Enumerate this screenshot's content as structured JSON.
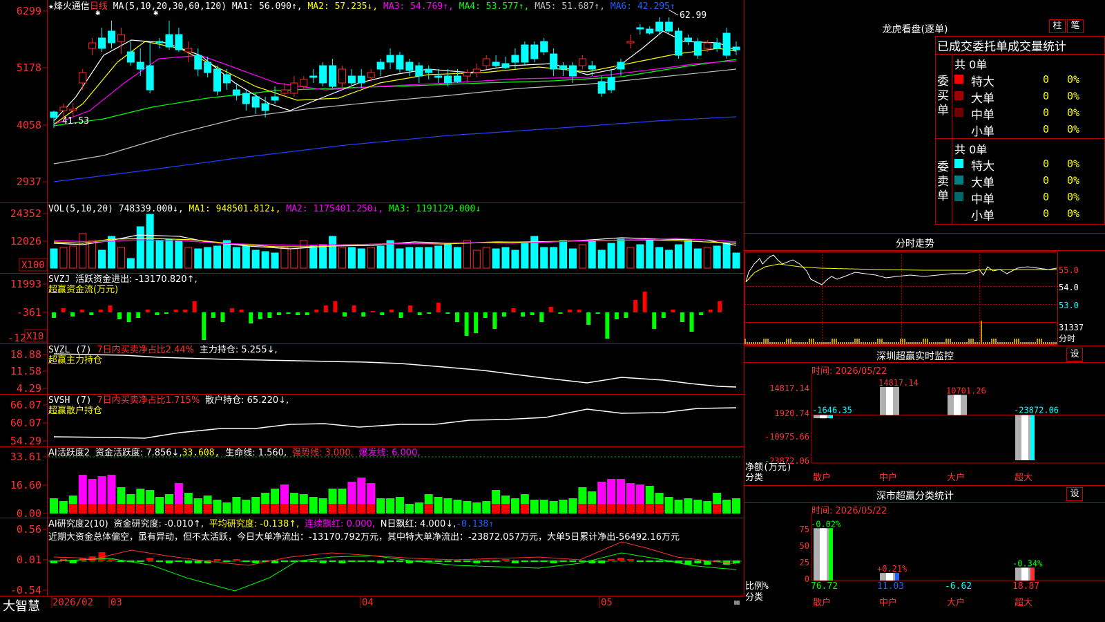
{
  "colors": {
    "up": "#ff2a2a",
    "down": "#00ffff",
    "bg": "#000000",
    "grid": "#c00000",
    "ma1": "#ffffff",
    "ma2": "#ffff00",
    "ma3": "#ff00ff",
    "ma4": "#00ff00",
    "ma5": "#c0c0c0",
    "ma6": "#2040ff",
    "green": "#00ff00",
    "yellow": "#ffff00",
    "magenta": "#ff00ff",
    "axis_text": "#ff3030"
  },
  "kline": {
    "star": "★",
    "name": "烽火通信",
    "period": "日线",
    "ma_prefix": "MA(5,10,20,30,60,120)",
    "ma1": "MA1: 56.090↑,",
    "ma2": "MA2: 57.235↓,",
    "ma3": "MA3: 54.769↑,",
    "ma4": "MA4: 53.577↑,",
    "ma5": "MA5: 51.687↑,",
    "ma6": "MA6: 42.295↑",
    "axis": [
      "6299",
      "5178",
      "4058",
      "2937"
    ],
    "high_label": "62.99",
    "low_label": "41.53"
  },
  "vol": {
    "title": "VOL(5,10,20)",
    "value": "748339.000↓,",
    "ma1": "MA1: 948501.812↓,",
    "ma2": "MA2: 1175401.250↓,",
    "ma3": "MA3: 1191129.000↓",
    "axis": [
      "24352",
      "12026"
    ],
    "unit": "X100"
  },
  "svzj": {
    "title": "SVZJ",
    "title2": "活跃资金进出: -13170.820↑,",
    "sub": "超赢资金流(万元)",
    "axis": [
      "11993",
      "-361",
      "-12"
    ],
    "unit": "X10"
  },
  "svzl": {
    "title": "SVZL (7)",
    "red": "7日内买卖净占比2.44%",
    "white": "主力持仓: 5.255↓,",
    "sub": "超赢主力持仓",
    "axis": [
      "18.88",
      "11.58",
      "4.29"
    ]
  },
  "svsh": {
    "title": "SVSH (7)",
    "red": "7日内买卖净占比1.715%",
    "white": "散户持仓: 65.220↓,",
    "sub": "超赢散户持仓",
    "axis": [
      "66.07",
      "60.07",
      "54.29"
    ]
  },
  "ai1": {
    "title": "AI活跃度2",
    "t1": "资金活跃度: 7.856↓,",
    "t2": "33.608,",
    "t3": "生命线: 1.560,",
    "t4": "强势线: 3.000,",
    "t5": "爆发线: 6.000,",
    "axis": [
      "33.61",
      "16.60",
      "0.00"
    ]
  },
  "ai2": {
    "title": "AI研究度2(10)",
    "t1": "资金研究度: -0.010↑,",
    "t2": "平均研究度: -0.138↑,",
    "t3": "连续飘红: 0.000,",
    "t4": "N日飘红: 4.000↓,",
    "t5": "-0.138↑",
    "comment": "近期大资金总体偏空，虽有异动，但不太活跃，今日大单净流出：-13170.792万元，其中特大单净流出：-23872.057万元，大单5日累计净出-56492.16万元",
    "axis": [
      "0.56",
      "0.01",
      "-0.54"
    ]
  },
  "bottom": {
    "logo": "大智慧",
    "dates": [
      "2026/02",
      "03",
      "04",
      "05"
    ]
  },
  "dragon": {
    "title": "龙虎看盘(逐单)",
    "btn1": "柱",
    "btn2": "笔",
    "head": "已成交委托单成交量统计",
    "buy_label": "委买单",
    "buy_total": "共 0单",
    "buy_rows": [
      {
        "name": "特大",
        "v": "0",
        "p": "0%",
        "c": "#ff0000"
      },
      {
        "name": "大单",
        "v": "0",
        "p": "0%",
        "c": "#a00000"
      },
      {
        "name": "中单",
        "v": "0",
        "p": "0%",
        "c": "#700000"
      },
      {
        "name": "小单",
        "v": "0",
        "p": "0%",
        "c": ""
      }
    ],
    "sell_label": "委卖单",
    "sell_total": "共 0单",
    "sell_rows": [
      {
        "name": "特大",
        "v": "0",
        "p": "0%",
        "c": "#00ffff"
      },
      {
        "name": "大单",
        "v": "0",
        "p": "0%",
        "c": "#008080"
      },
      {
        "name": "中单",
        "v": "0",
        "p": "0%",
        "c": "#006a6a"
      },
      {
        "name": "小单",
        "v": "0",
        "p": "0%",
        "c": ""
      }
    ]
  },
  "intraday": {
    "title": "分时走势",
    "axis": [
      "55.0",
      "54.0",
      "53.0"
    ],
    "vol_label": "31337",
    "foot": "分时"
  },
  "sz_monitor": {
    "title": "深圳超赢实时监控",
    "btn": "设",
    "time": "时间: 2026/05/22",
    "ylabel": "净额(万元)",
    "xlabel": "分类",
    "axis": [
      "14817.14",
      "1920.74",
      "-10975.66",
      "-23872.06"
    ],
    "bars": [
      {
        "name": "散户",
        "value": -1646.35,
        "label": "-1646.35",
        "lc": "#00ffff"
      },
      {
        "name": "中户",
        "value": 14817.14,
        "label": "14817.14",
        "lc": "#ff3030"
      },
      {
        "name": "大户",
        "value": 10701.26,
        "label": "10701.26",
        "lc": "#ff3030"
      },
      {
        "name": "超大",
        "value": -23872.06,
        "label": "-23872.06",
        "lc": "#00ffff"
      }
    ]
  },
  "sz_class": {
    "title": "深市超赢分类统计",
    "btn": "设",
    "time": "时间: 2026/05/22",
    "ylabel": "比例%",
    "xlabel": "分类",
    "axis": [
      "75",
      "50",
      "25",
      "0"
    ],
    "bars": [
      {
        "name": "散户",
        "ratio": 76.72,
        "change": "-0.02%",
        "cc": "#00ff00",
        "ratio_label": "76.72",
        "rc": "#00ff00"
      },
      {
        "name": "中户",
        "ratio": 11.03,
        "change": "+0.21%",
        "cc": "#ff3030",
        "ratio_label": "11.03",
        "rc": "#2060ff"
      },
      {
        "name": "大户",
        "ratio": -6.62,
        "change": "",
        "cc": "#ff3030",
        "ratio_label": "-6.62",
        "rc": "#00ffff"
      },
      {
        "name": "超大",
        "ratio": 18.87,
        "change": "-0.34%",
        "cc": "#00ff00",
        "ratio_label": "18.87",
        "rc": "#ff3030"
      }
    ]
  }
}
